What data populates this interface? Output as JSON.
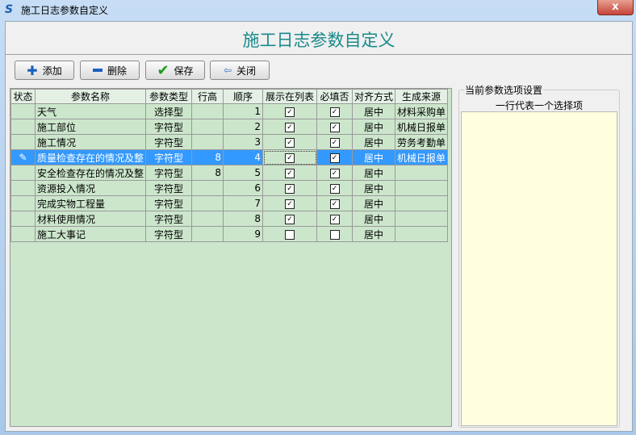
{
  "window": {
    "title": "施工日志参数自定义",
    "close": "x"
  },
  "header": {
    "title": "施工日志参数自定义"
  },
  "toolbar": {
    "add": "添加",
    "delete": "删除",
    "save": "保存",
    "close": "关闭"
  },
  "grid": {
    "columns": [
      "状态",
      "参数名称",
      "参数类型",
      "行高",
      "顺序",
      "展示在列表",
      "必填否",
      "对齐方式",
      "生成来源"
    ],
    "rows": [
      {
        "name": "天气",
        "type": "选择型",
        "height": "",
        "order": "1",
        "show": true,
        "required": true,
        "align": "居中",
        "source": "材料采购单"
      },
      {
        "name": "施工部位",
        "type": "字符型",
        "height": "",
        "order": "2",
        "show": true,
        "required": true,
        "align": "居中",
        "source": "机械日报单"
      },
      {
        "name": "施工情况",
        "type": "字符型",
        "height": "",
        "order": "3",
        "show": true,
        "required": true,
        "align": "居中",
        "source": "劳务考勤单"
      },
      {
        "name": "质量检查存在的情况及整",
        "type": "字符型",
        "height": "8",
        "order": "4",
        "show": true,
        "required": true,
        "align": "居中",
        "source": "机械日报单",
        "selected": true
      },
      {
        "name": "安全检查存在的情况及整",
        "type": "字符型",
        "height": "8",
        "order": "5",
        "show": true,
        "required": true,
        "align": "居中",
        "source": ""
      },
      {
        "name": "资源投入情况",
        "type": "字符型",
        "height": "",
        "order": "6",
        "show": true,
        "required": true,
        "align": "居中",
        "source": ""
      },
      {
        "name": "完成实物工程量",
        "type": "字符型",
        "height": "",
        "order": "7",
        "show": true,
        "required": true,
        "align": "居中",
        "source": ""
      },
      {
        "name": "材料使用情况",
        "type": "字符型",
        "height": "",
        "order": "8",
        "show": true,
        "required": true,
        "align": "居中",
        "source": ""
      },
      {
        "name": "施工大事记",
        "type": "字符型",
        "height": "",
        "order": "9",
        "show": false,
        "required": false,
        "align": "居中",
        "source": ""
      }
    ]
  },
  "options": {
    "group_label": "当前参数选项设置",
    "hint": "一行代表一个选择项",
    "value": ""
  }
}
